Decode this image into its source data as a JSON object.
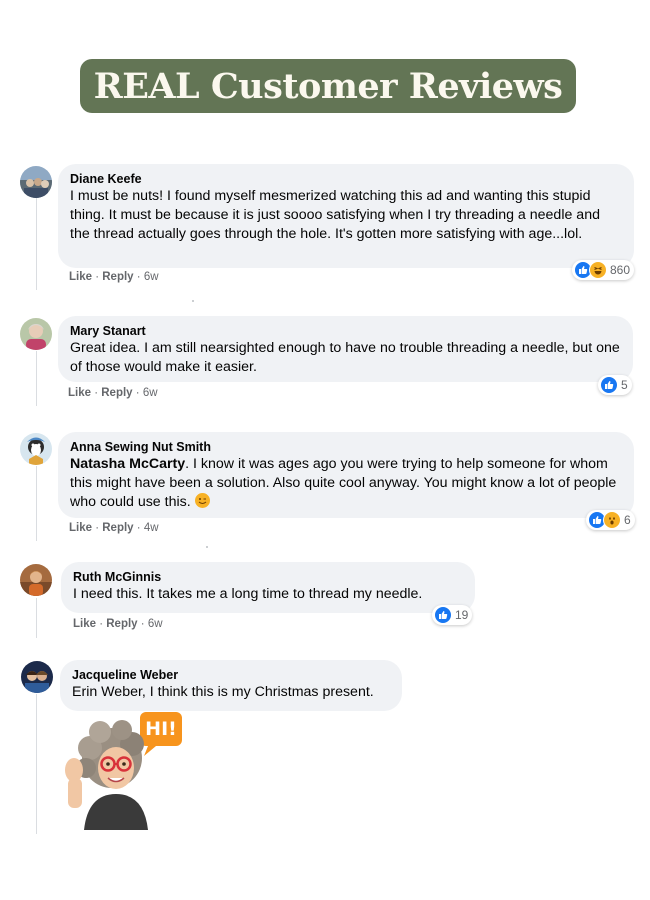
{
  "banner": {
    "title": "REAL Customer Reviews"
  },
  "comments": [
    {
      "author": "Diane Keefe",
      "text": "I must be nuts! I found myself mesmerized watching this ad and wanting this stupid thing. It must be because it is just soooo satisfying when I try threading a needle and the thread actually goes through the hole. It's gotten more satisfying with age...lol.",
      "like": "Like",
      "reply": "Reply",
      "time": "6w",
      "reaction_count": "860",
      "reactions": [
        "like-icon",
        "haha-icon"
      ]
    },
    {
      "author": "Mary Stanart",
      "text": "Great idea. I am still nearsighted enough to have no trouble threading a needle, but one of those would make it easier.",
      "like": "Like",
      "reply": "Reply",
      "time": "6w",
      "reaction_count": "5",
      "reactions": [
        "like-icon"
      ]
    },
    {
      "author": "Anna Sewing Nut Smith",
      "mention": "Natasha McCarty",
      "text": ". I know it was ages ago you were trying to help someone for whom this might have been a solution. Also quite cool anyway. You might know a lot of people who could use this.",
      "like": "Like",
      "reply": "Reply",
      "time": "4w",
      "reaction_count": "6",
      "reactions": [
        "like-icon",
        "wow-icon"
      ]
    },
    {
      "author": "Ruth McGinnis",
      "text": "I need this. It takes me a long time to thread my needle.",
      "like": "Like",
      "reply": "Reply",
      "time": "6w",
      "reaction_count": "19",
      "reactions": [
        "like-icon"
      ]
    },
    {
      "author": "Jacqueline Weber",
      "text": "Erin Weber, I think this is my Christmas present.",
      "sticker_text": "HI!"
    }
  ],
  "separator": " · ",
  "colors": {
    "banner_bg": "#637555",
    "banner_text": "#fbf8ee",
    "bubble_bg": "#f0f2f5",
    "like_blue": "#1877f2",
    "emoji_yellow": "#f7b125",
    "meta_gray": "#65676b"
  }
}
